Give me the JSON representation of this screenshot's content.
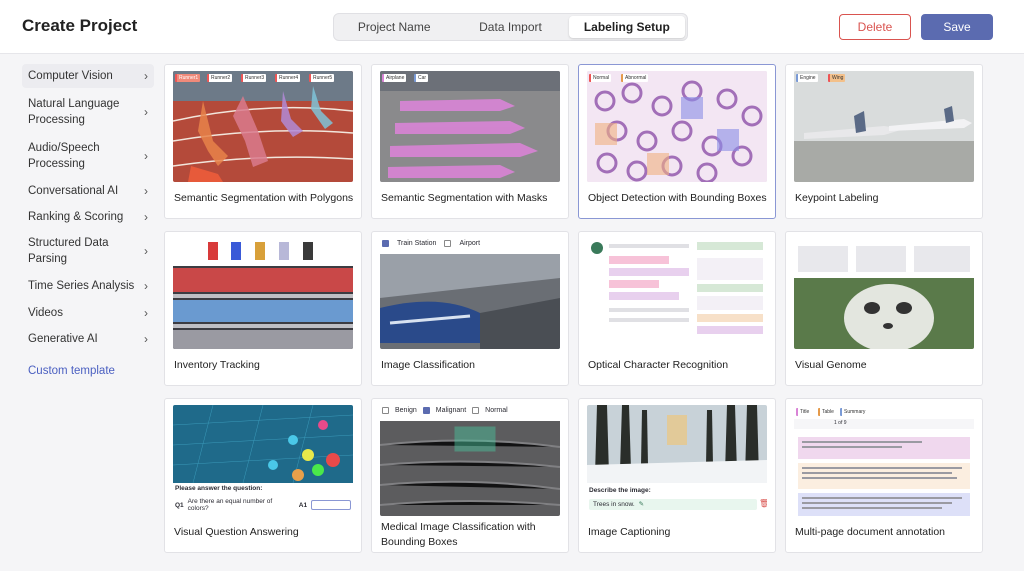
{
  "header": {
    "title": "Create Project",
    "steps": [
      "Project Name",
      "Data Import",
      "Labeling Setup"
    ],
    "active_step": "Labeling Setup",
    "delete_label": "Delete",
    "save_label": "Save"
  },
  "sidebar": {
    "items": [
      {
        "label": "Computer Vision"
      },
      {
        "label": "Natural Language Processing"
      },
      {
        "label": "Audio/Speech Processing"
      },
      {
        "label": "Conversational AI"
      },
      {
        "label": "Ranking & Scoring"
      },
      {
        "label": "Structured Data Parsing"
      },
      {
        "label": "Time Series Analysis"
      },
      {
        "label": "Videos"
      },
      {
        "label": "Generative AI"
      }
    ],
    "custom_template": "Custom template"
  },
  "templates": [
    {
      "label": "Semantic Segmentation with Polygons",
      "chips": [
        "Runner1",
        "Runner2",
        "Runner3",
        "Runner4",
        "Runner5"
      ]
    },
    {
      "label": "Semantic Segmentation with Masks",
      "chips": [
        "Airplane",
        "Car"
      ]
    },
    {
      "label": "Object Detection with Bounding Boxes",
      "chips": [
        "Normal",
        "Abnormal"
      ]
    },
    {
      "label": "Keypoint Labeling",
      "chips": [
        "Engine",
        "Wing"
      ]
    },
    {
      "label": "Inventory Tracking"
    },
    {
      "label": "Image Classification",
      "choices": [
        "Train Station",
        "Airport"
      ]
    },
    {
      "label": "Optical Character Recognition"
    },
    {
      "label": "Visual Genome"
    },
    {
      "label": "Visual Question Answering",
      "question_prompt": "Please answer the question:",
      "q_label": "Q1",
      "q_text": "Are there an equal number of colors?",
      "a_label": "A1"
    },
    {
      "label": "Medical Image Classification with Bounding Boxes",
      "choices": [
        "Benign",
        "Malignant",
        "Normal"
      ]
    },
    {
      "label": "Image Captioning",
      "describe_prompt": "Describe the image:",
      "caption": "Trees in snow."
    },
    {
      "label": "Multi-page document annotation",
      "chips": [
        "Title",
        "Table",
        "Summary"
      ],
      "pager": "1 of 9"
    }
  ],
  "colors": {
    "accent": "#5b6bb0",
    "danger": "#d9534f",
    "link": "#4a5fc1"
  }
}
